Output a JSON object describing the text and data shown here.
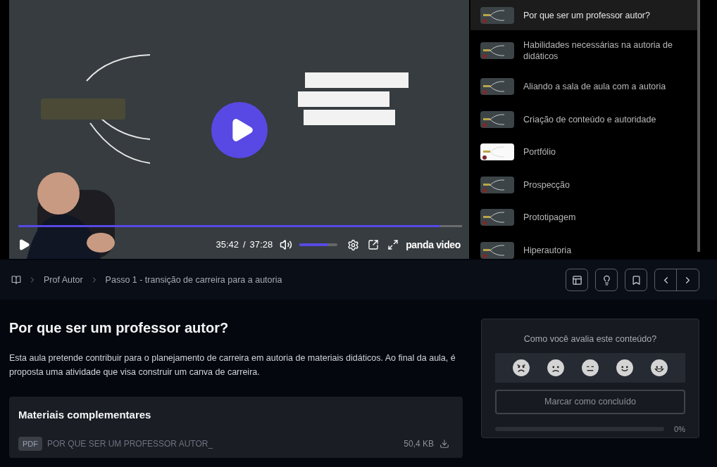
{
  "player": {
    "progress": {
      "level": 0.95
    },
    "time_current": "35:42",
    "time_separator": "/",
    "time_total": "37:28",
    "volume": {
      "level": 0.75
    },
    "brand": "panda video"
  },
  "playlist": [
    {
      "title": "Por que ser um professor autor?",
      "selected": true,
      "kind": "dark"
    },
    {
      "title": "Habilidades necessárias na autoria de didáticos",
      "selected": false,
      "kind": "dark"
    },
    {
      "title": "Aliando a sala de aula com a autoria",
      "selected": false,
      "kind": "dark"
    },
    {
      "title": "Criação de conteúdo e autoridade",
      "selected": false,
      "kind": "dark"
    },
    {
      "title": "Portfólio",
      "selected": false,
      "kind": "light"
    },
    {
      "title": "Prospecção",
      "selected": false,
      "kind": "dark"
    },
    {
      "title": "Prototipagem",
      "selected": false,
      "kind": "dark"
    },
    {
      "title": "Hiperautoria",
      "selected": false,
      "kind": "dark"
    }
  ],
  "breadcrumb": [
    "Prof Autor",
    "Passo 1 - transição de carreira para a autoria"
  ],
  "lesson": {
    "title": "Por que ser um professor autor?",
    "description": "Esta aula pretende contribuir para o planejamento de carreira em autoria de materiais didáticos. Ao final da aula, é proposta uma atividade que visa construir um canva de carreira."
  },
  "materials": {
    "heading": "Materiais complementares",
    "files": [
      {
        "badge": "PDF",
        "name": "POR QUE SER UM PROFESSOR AUTOR_",
        "size": "50,4 KB"
      }
    ]
  },
  "rating": {
    "question": "Como você avalia este conteúdo?",
    "button": "Marcar como concluído",
    "progress": {
      "level": 0
    },
    "percent": "0%"
  }
}
